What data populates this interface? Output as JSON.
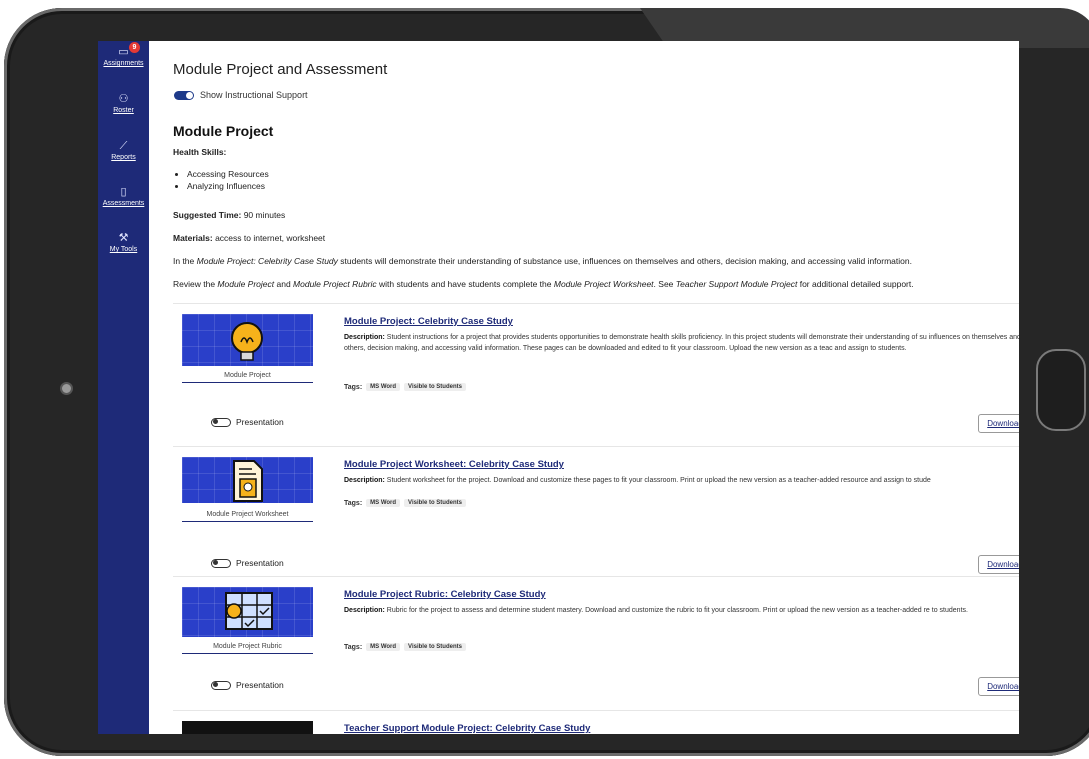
{
  "sidebar": {
    "badge_count": "9",
    "items": [
      {
        "label": "Assignments",
        "icon": "assignments-icon"
      },
      {
        "label": "Roster",
        "icon": "roster-icon"
      },
      {
        "label": "Reports",
        "icon": "reports-icon"
      },
      {
        "label": "Assessments",
        "icon": "assessments-icon"
      },
      {
        "label": "My Tools",
        "icon": "tools-icon"
      }
    ]
  },
  "page": {
    "title": "Module Project and Assessment",
    "toggle_label": "Show Instructional Support",
    "section_title": "Module Project",
    "health_skills_label": "Health Skills:",
    "skills": [
      "Accessing Resources",
      "Analyzing Influences"
    ],
    "suggested_time_label": "Suggested Time:",
    "suggested_time": "90 minutes",
    "materials_label": "Materials:",
    "materials": "access to internet, worksheet",
    "para1_a": "In the ",
    "para1_em": "Module Project: Celebrity Case Study",
    "para1_b": " students will demonstrate their understanding of substance use, influences on themselves and others, decision making, and accessing valid information.",
    "para2_a": "Review the ",
    "para2_em1": "Module Project",
    "para2_b": " and ",
    "para2_em2": "Module Project Rubric",
    "para2_c": " with students and have students complete the ",
    "para2_em3": "Module Project Worksheet",
    "para2_d": ". See ",
    "para2_em4": "Teacher Support Module Project",
    "para2_e": " for additional detailed support."
  },
  "resources": [
    {
      "title": "Module Project: Celebrity Case Study",
      "thumb_caption": "Module Project",
      "desc_label": "Description:",
      "description": "Student instructions for a project that provides students opportunities to demonstrate health skills proficiency. In this project students will demonstrate their understanding of su influences on themselves and others, decision making, and accessing valid information. These pages can be downloaded and edited to fit your classroom. Upload the new version as a teac and assign to students.",
      "tags_label": "Tags:",
      "tags": [
        "MS Word",
        "Visible to Students"
      ],
      "presentation_label": "Presentation",
      "download_label": "Download"
    },
    {
      "title": "Module Project Worksheet: Celebrity Case Study",
      "thumb_caption": "Module Project Worksheet",
      "desc_label": "Description:",
      "description": "Student worksheet for the project. Download and customize these pages to fit your classroom. Print or upload the new version as a teacher-added resource and assign to stude",
      "tags_label": "Tags:",
      "tags": [
        "MS Word",
        "Visible to Students"
      ],
      "presentation_label": "Presentation",
      "download_label": "Download"
    },
    {
      "title": "Module Project Rubric: Celebrity Case Study",
      "thumb_caption": "Module Project Rubric",
      "desc_label": "Description:",
      "description": "Rubric for the project to assess and determine student mastery. Download and customize the rubric to fit your classroom. Print or upload the new version as a teacher-added re to students.",
      "tags_label": "Tags:",
      "tags": [
        "MS Word",
        "Visible to Students"
      ],
      "presentation_label": "Presentation",
      "download_label": "Download"
    },
    {
      "title": "Teacher Support Module Project: Celebrity Case Study"
    }
  ]
}
